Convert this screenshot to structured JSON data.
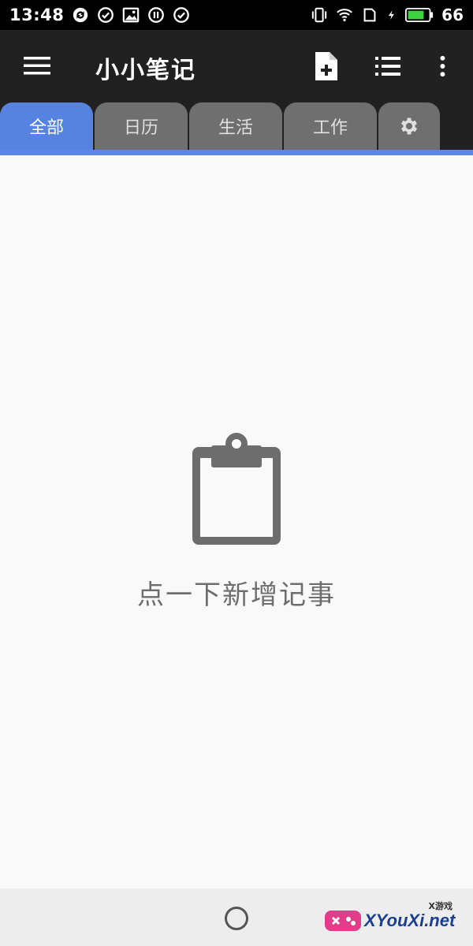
{
  "status_bar": {
    "time": "13:48",
    "battery_level": "66",
    "icons_left": [
      "sync-icon",
      "check-circle-icon",
      "image-icon",
      "pause-circle-icon",
      "check-circle-icon"
    ],
    "icons_right": [
      "vibrate-icon",
      "wifi-icon",
      "sim-icon",
      "charging-icon",
      "battery-icon"
    ]
  },
  "app_bar": {
    "title": "小小笔记",
    "actions": [
      "new-note-icon",
      "list-view-icon",
      "more-vert-icon"
    ]
  },
  "tabs": [
    {
      "label": "全部",
      "active": true
    },
    {
      "label": "日历",
      "active": false
    },
    {
      "label": "生活",
      "active": false
    },
    {
      "label": "工作",
      "active": false
    }
  ],
  "settings_tab_icon": "gear-icon",
  "empty_state": {
    "icon": "clipboard-icon",
    "text": "点一下新增记事"
  },
  "watermark": {
    "text": "XYouXi.net",
    "small_text": "X游戏"
  },
  "colors": {
    "accent": "#5783e0",
    "app_bar": "#212121",
    "tab_inactive": "#6f6f6f",
    "empty_icon": "#6d6d6d"
  }
}
